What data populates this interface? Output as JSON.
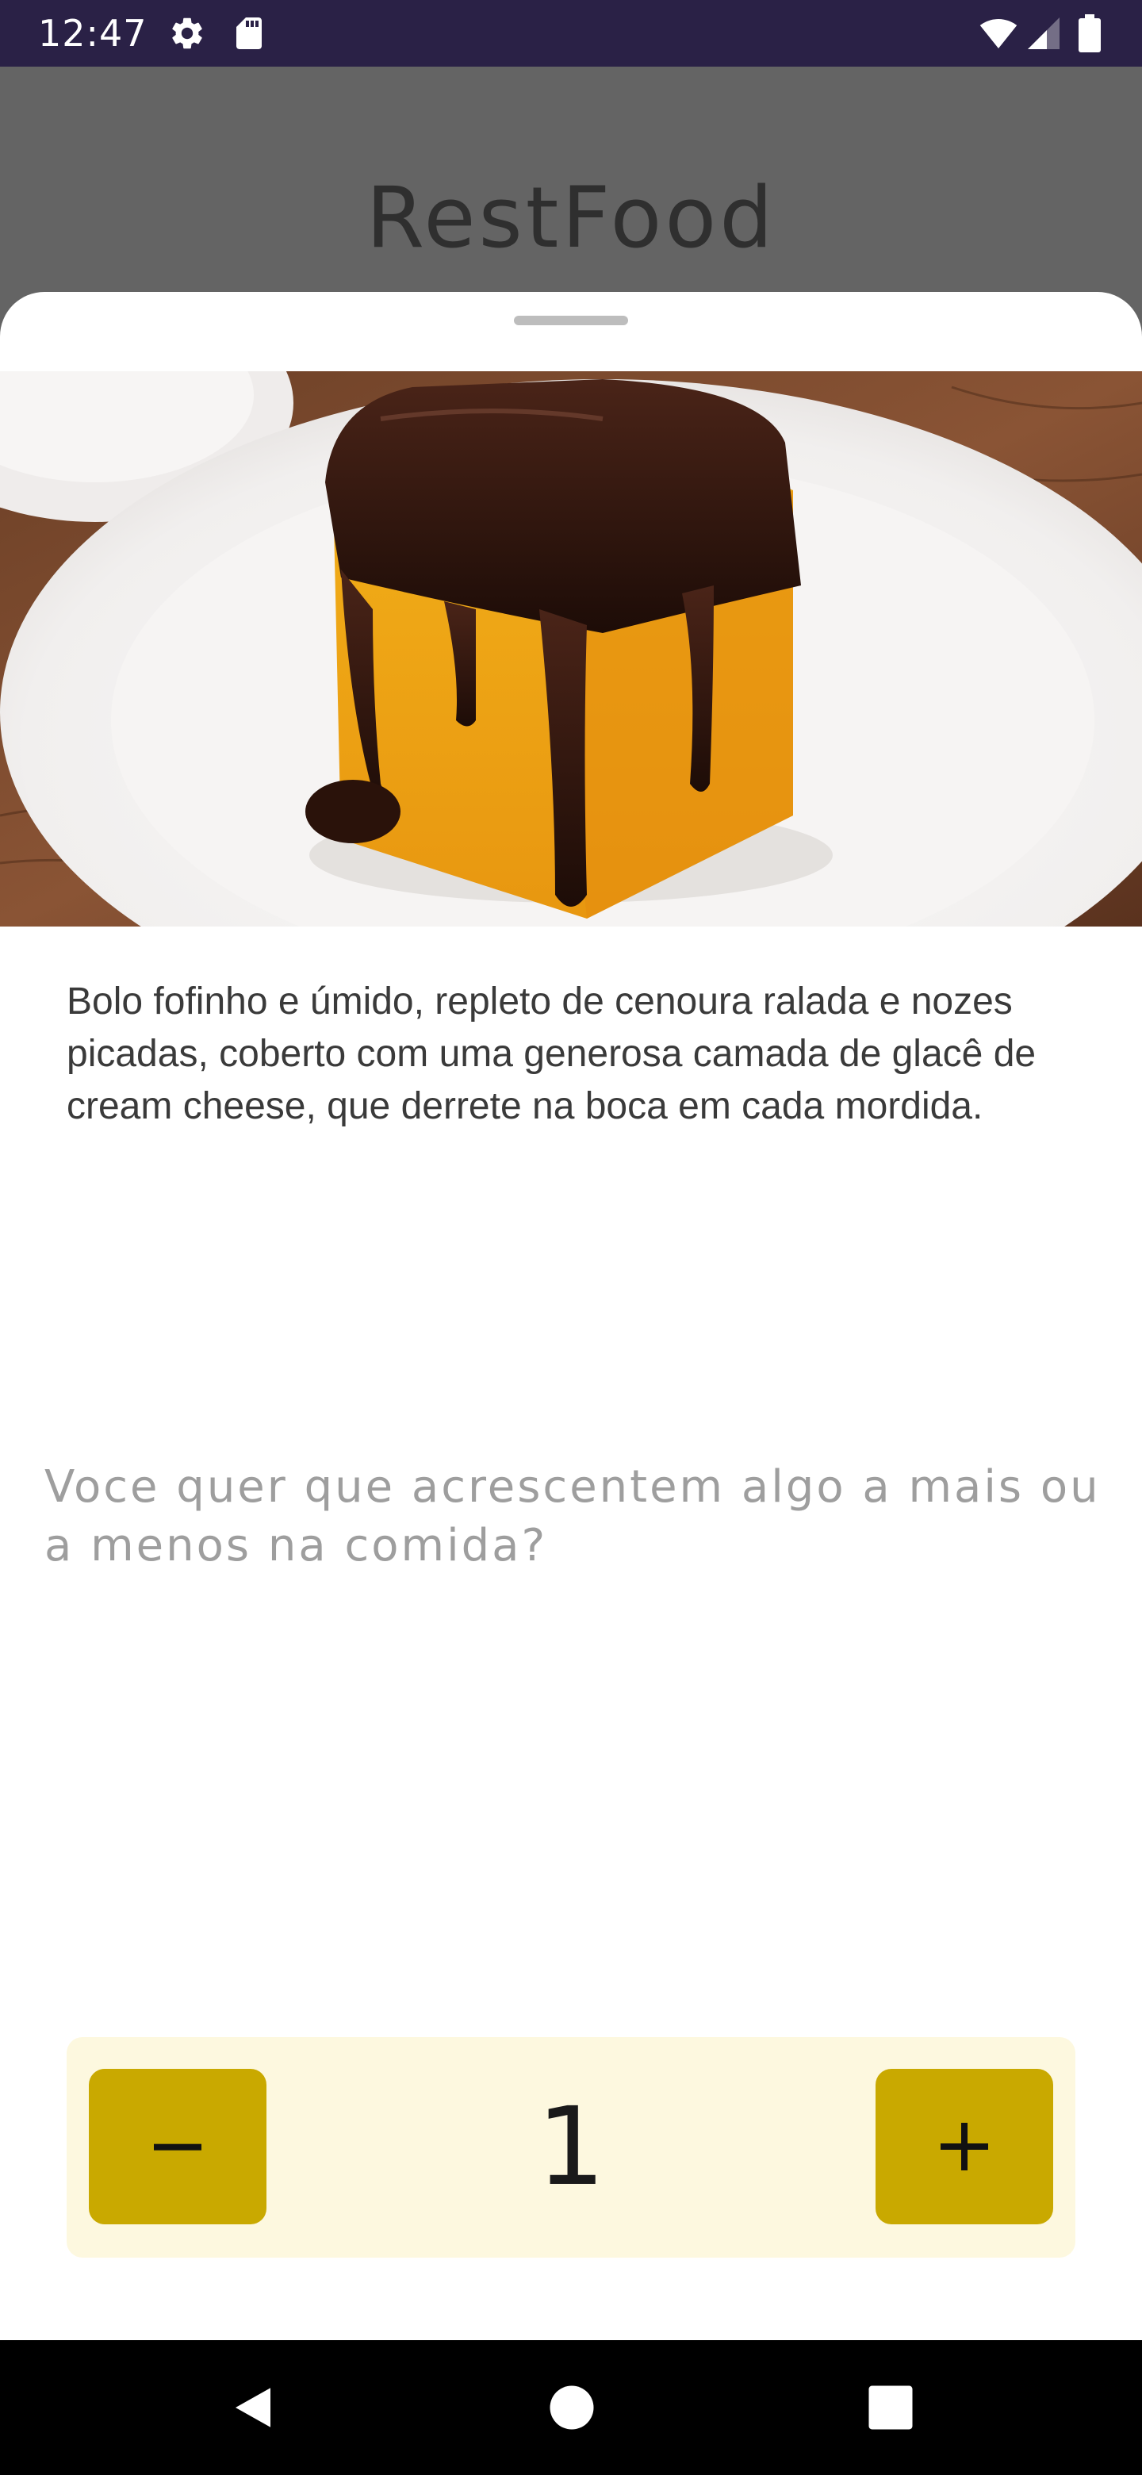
{
  "status_bar": {
    "time": "12:47",
    "icons": [
      "gear-icon",
      "sd-card-icon",
      "wifi-icon",
      "signal-icon",
      "battery-icon"
    ]
  },
  "app_bar": {
    "title": "RestFood"
  },
  "sheet": {
    "image": "carrot-cake-with-chocolate-icon",
    "description": "Bolo fofinho e úmido, repleto de cenoura ralada e nozes picadas, coberto com uma generosa camada de glacê de cream cheese, que derrete na boca em cada mordida.",
    "notes": {
      "value": "",
      "placeholder": "Voce quer que acrescentem algo a mais ou a menos na comida?"
    },
    "quantity": {
      "value": "1",
      "decrement_icon": "minus-icon",
      "increment_icon": "plus-icon"
    }
  },
  "nav_bar": {
    "icons": [
      "back-icon",
      "home-icon",
      "recents-icon"
    ]
  },
  "colors": {
    "status_bar": "#2a2146",
    "scrim": "#646464",
    "stepper_background": "#fdf8df",
    "stepper_button": "#c9a900",
    "placeholder": "#9e9e9e"
  }
}
